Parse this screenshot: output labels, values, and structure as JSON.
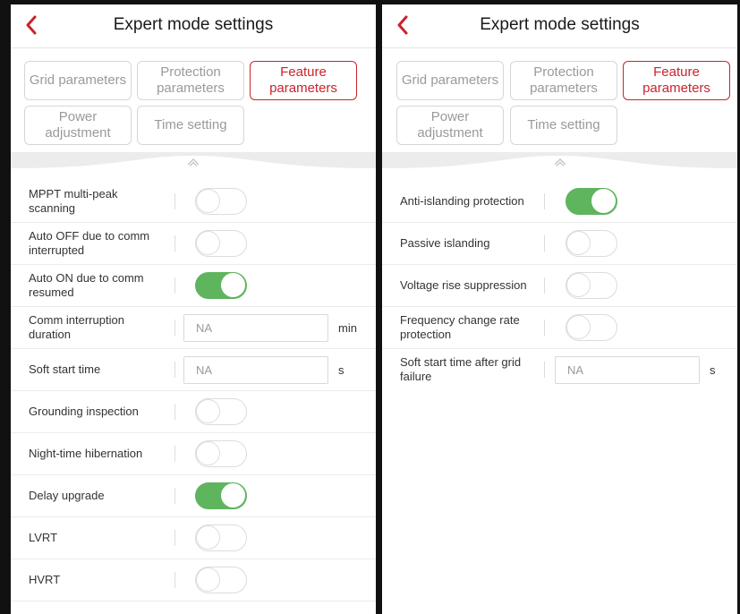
{
  "left": {
    "title": "Expert mode settings",
    "tabs": [
      {
        "label": "Grid parameters",
        "active": false
      },
      {
        "label": "Protection parameters",
        "active": false
      },
      {
        "label": "Feature parameters",
        "active": true
      },
      {
        "label": "Power adjustment",
        "active": false
      },
      {
        "label": "Time setting",
        "active": false
      }
    ],
    "rows": [
      {
        "label": "MPPT multi-peak scanning",
        "type": "toggle",
        "on": false
      },
      {
        "label": "Auto OFF due to comm interrupted",
        "type": "toggle",
        "on": false
      },
      {
        "label": "Auto ON due to comm resumed",
        "type": "toggle",
        "on": true
      },
      {
        "label": "Comm interruption duration",
        "type": "input",
        "value": "NA",
        "unit": "min"
      },
      {
        "label": "Soft start time",
        "type": "input",
        "value": "NA",
        "unit": "s"
      },
      {
        "label": "Grounding inspection",
        "type": "toggle",
        "on": false
      },
      {
        "label": "Night-time hibernation",
        "type": "toggle",
        "on": false
      },
      {
        "label": "Delay upgrade",
        "type": "toggle",
        "on": true
      },
      {
        "label": "LVRT",
        "type": "toggle",
        "on": false
      },
      {
        "label": "HVRT",
        "type": "toggle",
        "on": false
      }
    ]
  },
  "right": {
    "title": "Expert mode settings",
    "tabs": [
      {
        "label": "Grid parameters",
        "active": false
      },
      {
        "label": "Protection parameters",
        "active": false
      },
      {
        "label": "Feature parameters",
        "active": true
      },
      {
        "label": "Power adjustment",
        "active": false
      },
      {
        "label": "Time setting",
        "active": false
      }
    ],
    "rows": [
      {
        "label": "Anti-islanding protection",
        "type": "toggle",
        "on": true
      },
      {
        "label": "Passive islanding",
        "type": "toggle",
        "on": false
      },
      {
        "label": "Voltage rise suppression",
        "type": "toggle",
        "on": false
      },
      {
        "label": "Frequency change rate protection",
        "type": "toggle",
        "on": false
      },
      {
        "label": "Soft start time after grid failure",
        "type": "input",
        "value": "NA",
        "unit": "s"
      }
    ]
  },
  "colors": {
    "accent": "#c9242b",
    "toggle_on": "#5fb45e",
    "band": "#ececec"
  },
  "icons": {
    "back": "chevron-left-icon",
    "collapse": "chevron-up-icon"
  }
}
